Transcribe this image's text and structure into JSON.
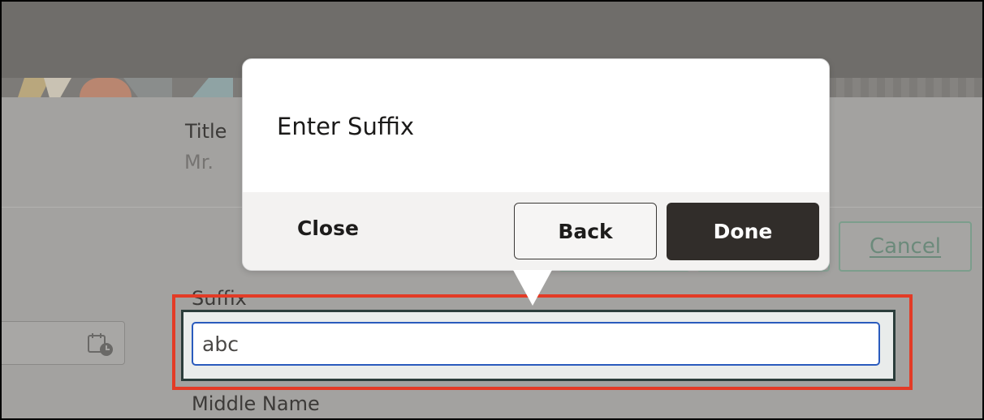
{
  "background_form": {
    "title_label": "Title",
    "title_value": "Mr.",
    "suffix_label": "Suffix",
    "middle_name_label": "Middle Name",
    "cancel_label": "Cancel",
    "date_icon": "calendar-clock-icon"
  },
  "suffix_field": {
    "value": "abc"
  },
  "popover": {
    "title": "Enter Suffix",
    "close_label": "Close",
    "back_label": "Back",
    "done_label": "Done"
  },
  "colors": {
    "highlight": "#e33b26",
    "input_focus": "#2a5bbd",
    "done_button": "#312d2a",
    "cancel_text": "#6c8a7b"
  }
}
